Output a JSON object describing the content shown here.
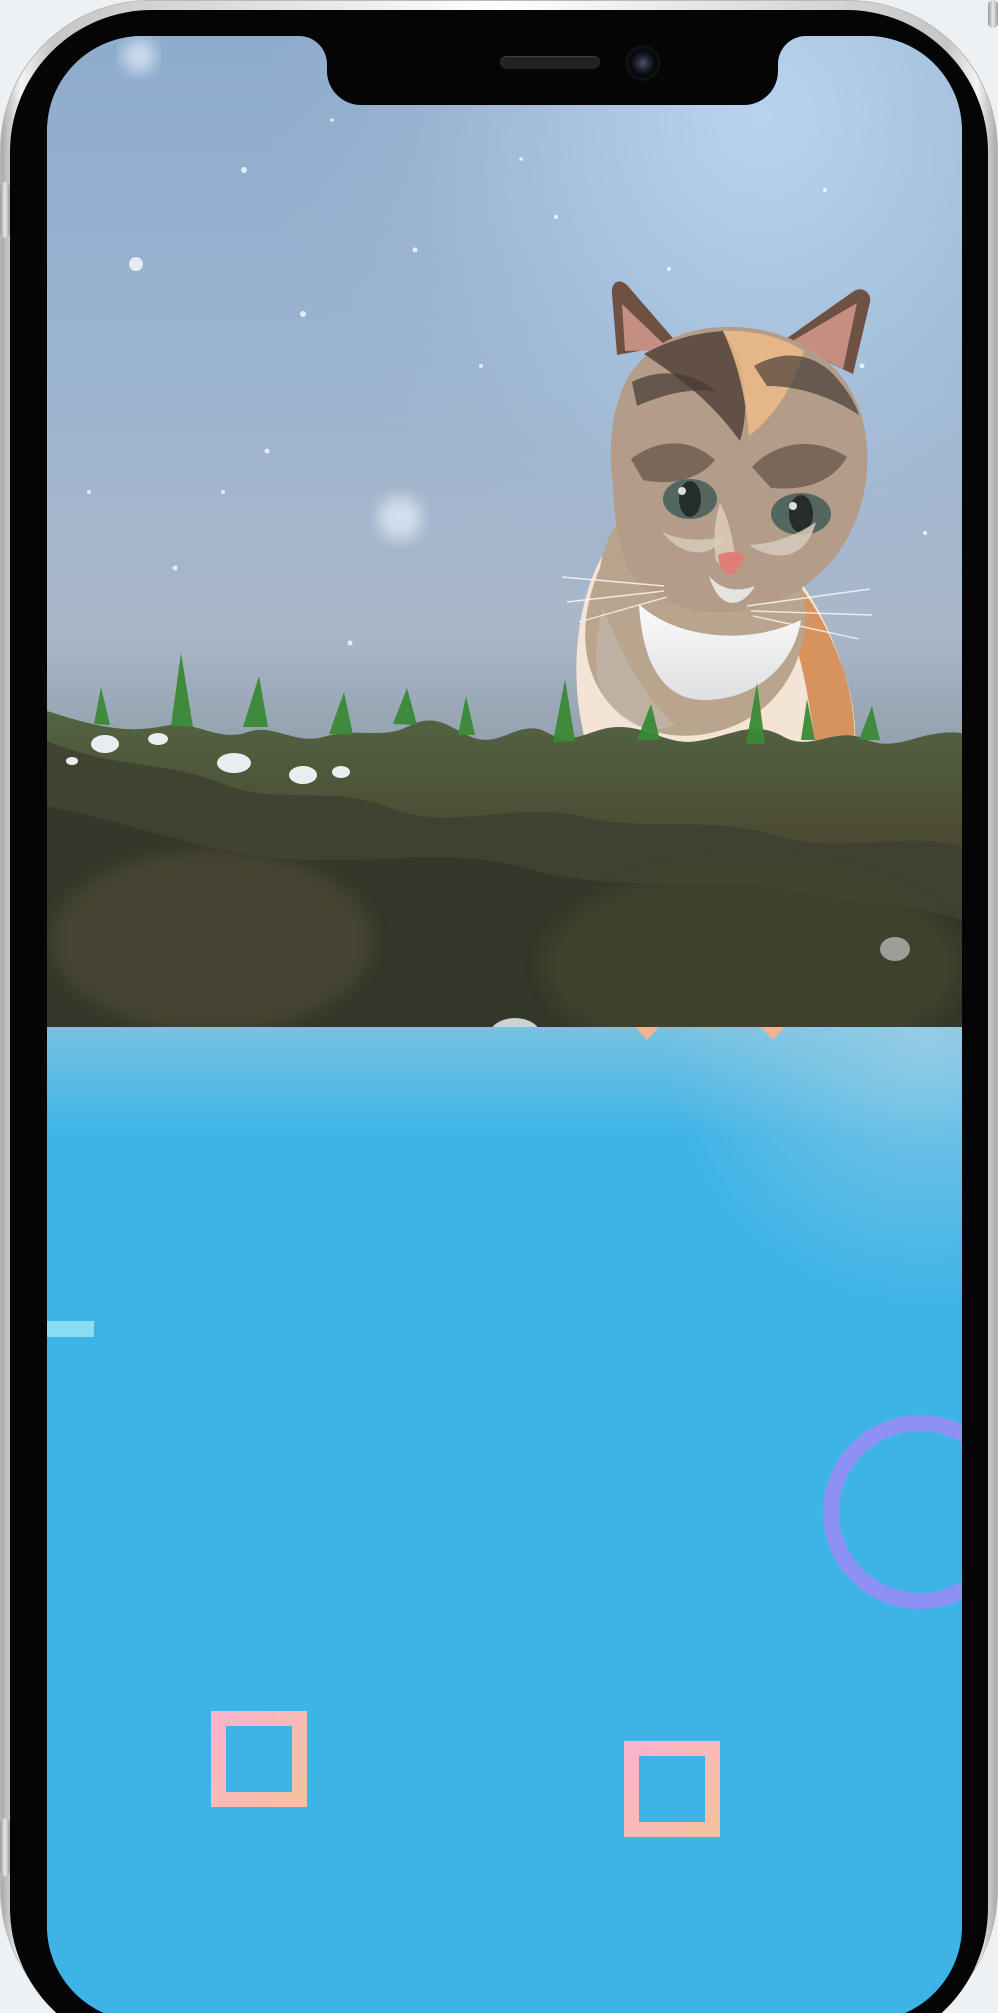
{
  "app": {
    "name": ""
  },
  "device": {
    "type": "phone-mockup"
  },
  "hero_photo": {
    "subject": "cat",
    "alt": ""
  },
  "icons": {
    "camera": "camera-icon",
    "speaker": "speaker-grille-icon"
  },
  "colors": {
    "screen_blue": "#3DB3E6",
    "pink_square": "#F8B4C8",
    "peach_square": "#F6C0A3",
    "violet_ring": "#8D91F5",
    "light_dash": "#8ADCF3"
  }
}
